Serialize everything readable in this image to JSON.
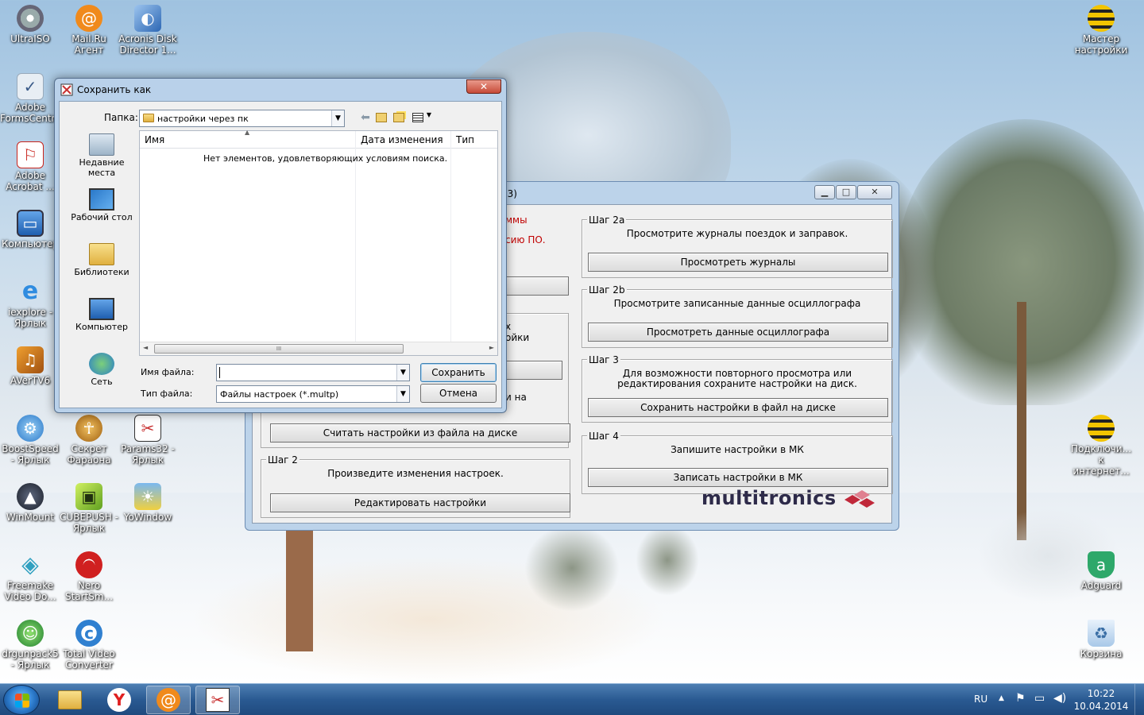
{
  "desktop": {
    "icons_left": [
      {
        "label": "UltraISO",
        "icon": "ultraiso-icon",
        "color": "#8a8fa3"
      },
      {
        "label": "Mail.Ru Агент",
        "icon": "mailru-agent-icon",
        "color": "#f08a1c"
      },
      {
        "label": "Acronis Disk Director 1...",
        "icon": "acronis-icon",
        "color": "#2d67b4"
      },
      {
        "label": "Adobe FormsCentr...",
        "icon": "adobe-formscentral-icon",
        "color": "#5a7fa8"
      },
      {
        "label": "Adobe Acrobat ...",
        "icon": "adobe-acrobat-icon",
        "color": "#c8241c"
      },
      {
        "label": "Компьютер",
        "icon": "computer-icon",
        "color": "#3a7fcf"
      },
      {
        "label": "iexplore - Ярлык",
        "icon": "internet-explorer-icon",
        "color": "#2f8ce0"
      },
      {
        "label": "AVerTV6",
        "icon": "avertv-icon",
        "color": "#e0801c"
      },
      {
        "label": "BoostSpeed - Ярлык",
        "icon": "boostspeed-icon",
        "color": "#3aa0e0"
      },
      {
        "label": "Секрет Фараона",
        "icon": "pharaoh-icon",
        "color": "#c08020"
      },
      {
        "label": "Params32 - Ярлык",
        "icon": "params32-icon",
        "color": "#c83030"
      },
      {
        "label": "WinMount",
        "icon": "winmount-icon",
        "color": "#303848"
      },
      {
        "label": "CUBEPUSH - Ярлык",
        "icon": "cubepush-icon",
        "color": "#80c030"
      },
      {
        "label": "YoWindow",
        "icon": "yowindow-icon",
        "color": "#f0c020"
      },
      {
        "label": "Freemake Video Do...",
        "icon": "freemake-icon",
        "color": "#30a0c0"
      },
      {
        "label": "Nero StartSm...",
        "icon": "nero-icon",
        "color": "#d02020"
      },
      {
        "label": "drgunpack5 - Ярлык",
        "icon": "drgunpack-icon",
        "color": "#30a040"
      },
      {
        "label": "Total Video Converter",
        "icon": "total-video-converter-icon",
        "color": "#3080d0"
      }
    ],
    "icons_right": [
      {
        "label": "Мастер настройки",
        "icon": "beeline-wizard-icon",
        "color": "#f2c400"
      },
      {
        "label": "Подключи... к интернет...",
        "icon": "beeline-connect-icon",
        "color": "#f2c400"
      },
      {
        "label": "Adguard",
        "icon": "adguard-icon",
        "color": "#2ea86a"
      },
      {
        "label": "Корзина",
        "icon": "recycle-bin-icon",
        "color": "#a8c8e8"
      }
    ]
  },
  "multitronics": {
    "title_fragment": "13)",
    "left_partial": {
      "line1": "ммы",
      "line2": "сию ПО.",
      "line3": "х",
      "line4": "ойки",
      "line5": "и на"
    },
    "step1_button": "Считать настройки из файла на диске",
    "step2": {
      "title": "Шаг 2",
      "text": "Произведите изменения настроек.",
      "button": "Редактировать настройки"
    },
    "step2a": {
      "title": "Шаг 2a",
      "text": "Просмотрите журналы поездок и заправок.",
      "button": "Просмотреть журналы"
    },
    "step2b": {
      "title": "Шаг 2b",
      "text": "Просмотрите записанные данные осциллографа",
      "button": "Просмотреть данные осциллографа"
    },
    "step3": {
      "title": "Шаг 3",
      "text_line1": "Для возможности повторного просмотра или",
      "text_line2": "редактирования сохраните настройки на диск.",
      "button": "Сохранить настройки в файл на диске"
    },
    "step4": {
      "title": "Шаг 4",
      "text": "Запишите настройки в МК",
      "button": "Записать настройки в МК"
    },
    "logo": "multitronics"
  },
  "save_dialog": {
    "title": "Сохранить как",
    "folder_label": "Папка:",
    "folder_value": "настройки через пк",
    "places": [
      {
        "label": "Недавние места",
        "icon": "recent-places-icon"
      },
      {
        "label": "Рабочий стол",
        "icon": "desktop-icon"
      },
      {
        "label": "Библиотеки",
        "icon": "libraries-icon"
      },
      {
        "label": "Компьютер",
        "icon": "computer-icon"
      },
      {
        "label": "Сеть",
        "icon": "network-icon"
      }
    ],
    "columns": [
      "Имя",
      "Дата изменения",
      "Тип"
    ],
    "empty_message": "Нет элементов, удовлетворяющих условиям поиска.",
    "scroll_grip": "III",
    "filename_label": "Имя файла:",
    "filename_value": "",
    "filetype_label": "Тип файла:",
    "filetype_value": "Файлы настроек (*.multp)",
    "save_button": "Сохранить",
    "cancel_button": "Отмена"
  },
  "taskbar": {
    "language": "RU",
    "time": "10:22",
    "date": "10.04.2014"
  }
}
